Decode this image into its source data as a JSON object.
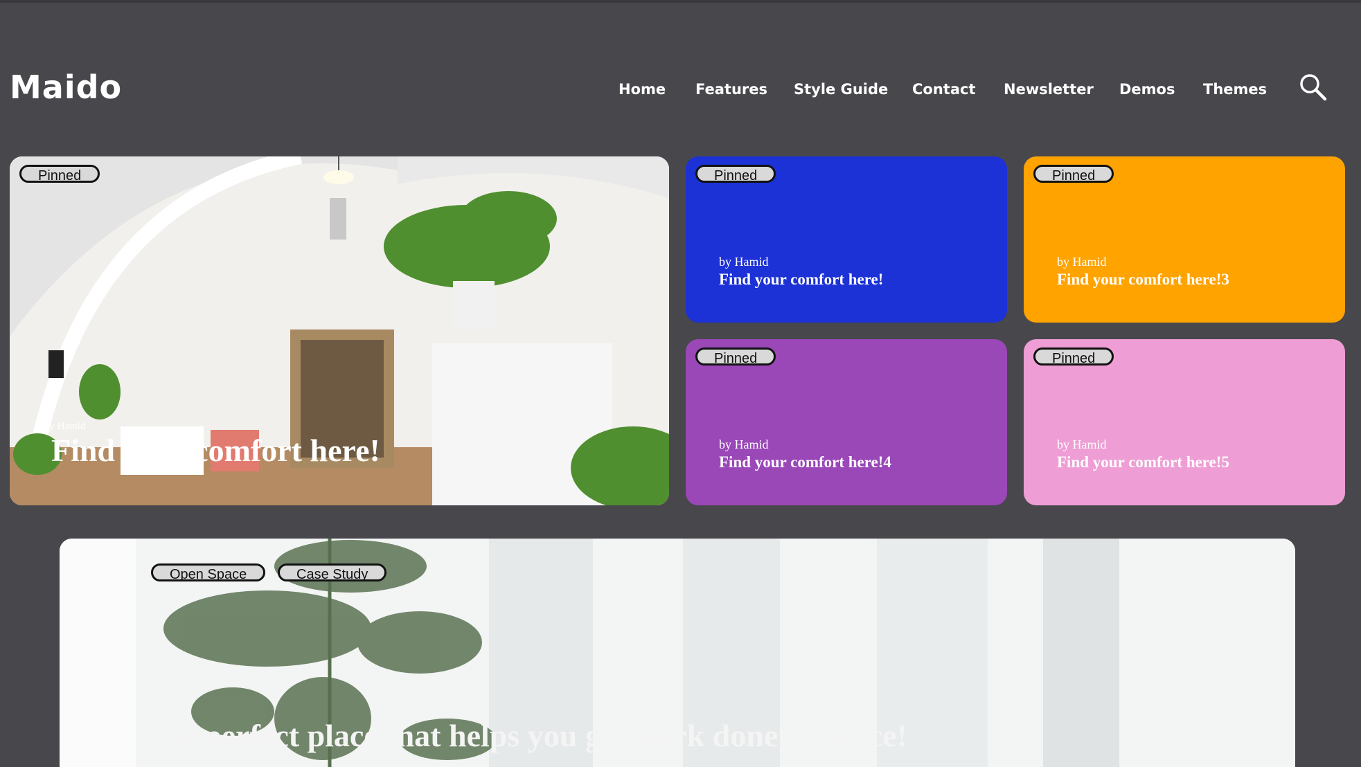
{
  "app": {
    "logo": "Maido"
  },
  "nav": {
    "items": [
      {
        "label": "Home"
      },
      {
        "label": "Features"
      },
      {
        "label": "Style Guide"
      },
      {
        "label": "Contact"
      },
      {
        "label": "Newsletter"
      },
      {
        "label": "Demos"
      },
      {
        "label": "Themes"
      }
    ],
    "search_icon": "search-icon"
  },
  "cards": [
    {
      "badge": "Pinned",
      "author": "by Hamid",
      "title": "Find your comfort here!",
      "color": "#efece6"
    },
    {
      "badge": "Pinned",
      "author": "by Hamid",
      "title": "Find your comfort here!",
      "color": "#1c31d6"
    },
    {
      "badge": "Pinned",
      "author": "by Hamid",
      "title": "Find your comfort here!3",
      "color": "#ffa300"
    },
    {
      "badge": "Pinned",
      "author": "by Hamid",
      "title": "Find your comfort here!4",
      "color": "#9a47b8"
    },
    {
      "badge": "Pinned",
      "author": "by Hamid",
      "title": "Find your comfort here!5",
      "color": "#ee9ed5"
    }
  ],
  "hero": {
    "tags": [
      "Open Space",
      "Case Study"
    ],
    "title": "The perfect place that helps you get work done in peace!"
  }
}
